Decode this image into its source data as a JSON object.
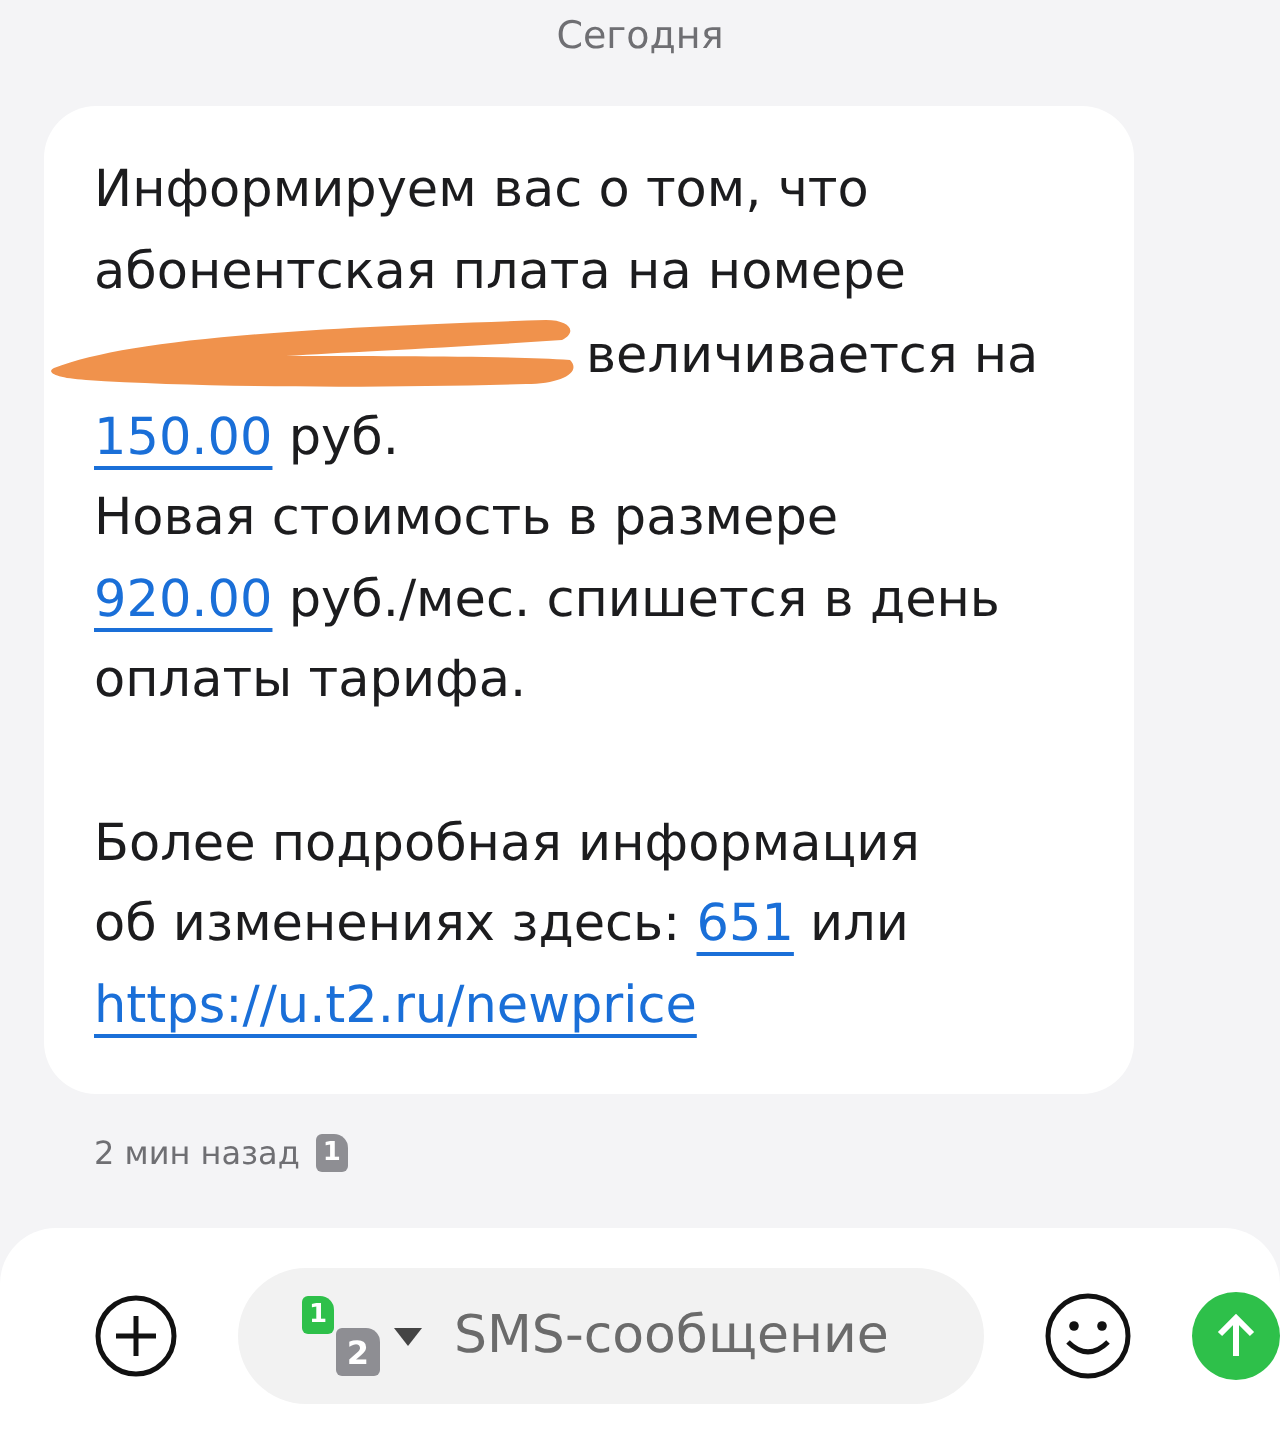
{
  "date_header": "Сегодня",
  "message": {
    "paragraphs": [
      [
        [
          {
            "kind": "text",
            "text": "Информируем вас о том, что"
          }
        ],
        [
          {
            "kind": "text",
            "text": "абонентская плата на номере"
          }
        ],
        [
          {
            "kind": "redaction"
          },
          {
            "kind": "text",
            "text": "величивается на"
          }
        ],
        [
          {
            "kind": "link",
            "text": "150.00"
          },
          {
            "kind": "text",
            "text": " руб."
          }
        ],
        [
          {
            "kind": "text",
            "text": "Новая стоимость в размере"
          }
        ],
        [
          {
            "kind": "link",
            "text": "920.00"
          },
          {
            "kind": "text",
            "text": " руб./мес. спишется в день"
          }
        ],
        [
          {
            "kind": "text",
            "text": "оплаты тарифа."
          }
        ]
      ],
      [
        [
          {
            "kind": "text",
            "text": "Более подробная информация"
          }
        ],
        [
          {
            "kind": "text",
            "text": "об изменениях здесь: "
          },
          {
            "kind": "link",
            "text": "651"
          },
          {
            "kind": "text",
            "text": " или"
          }
        ],
        [
          {
            "kind": "link",
            "text": "https://u.t2.ru/newprice"
          }
        ]
      ]
    ],
    "time": "2 мин назад",
    "sim": "1"
  },
  "composer": {
    "sim_primary": "1",
    "sim_secondary": "2",
    "placeholder": "SMS-сообщение"
  }
}
